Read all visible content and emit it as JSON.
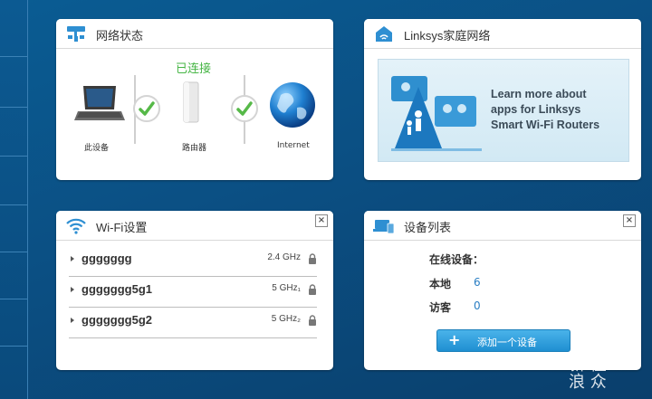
{
  "network_status": {
    "title": "网络状态",
    "connected": "已连接",
    "this_device": "此设备",
    "router": "路由器",
    "internet": "Internet"
  },
  "linksys_family": {
    "title": "Linksys家庭网络",
    "promo_line1": "Learn more about",
    "promo_line2": "apps for Linksys",
    "promo_line3": "Smart Wi-Fi Routers"
  },
  "wifi": {
    "title": "Wi-Fi设置",
    "close": "×",
    "networks": [
      {
        "ssid": "ggggggg",
        "band": "2.4 GHz"
      },
      {
        "ssid": "ggggggg5g1",
        "band": "5 GHz₁"
      },
      {
        "ssid": "ggggggg5g2",
        "band": "5 GHz₂"
      }
    ]
  },
  "devices": {
    "title": "设备列表",
    "close": "×",
    "online_label": "在线设备：",
    "local_label": "本地",
    "local_count": "6",
    "guest_label": "访客",
    "guest_count": "0",
    "add_button": "添加一个设备"
  },
  "watermark": {
    "line1": "新 值",
    "line2": "浪 众"
  },
  "colors": {
    "accent": "#1f8fd1",
    "connected": "#45b544",
    "background": "#0b4f83"
  }
}
